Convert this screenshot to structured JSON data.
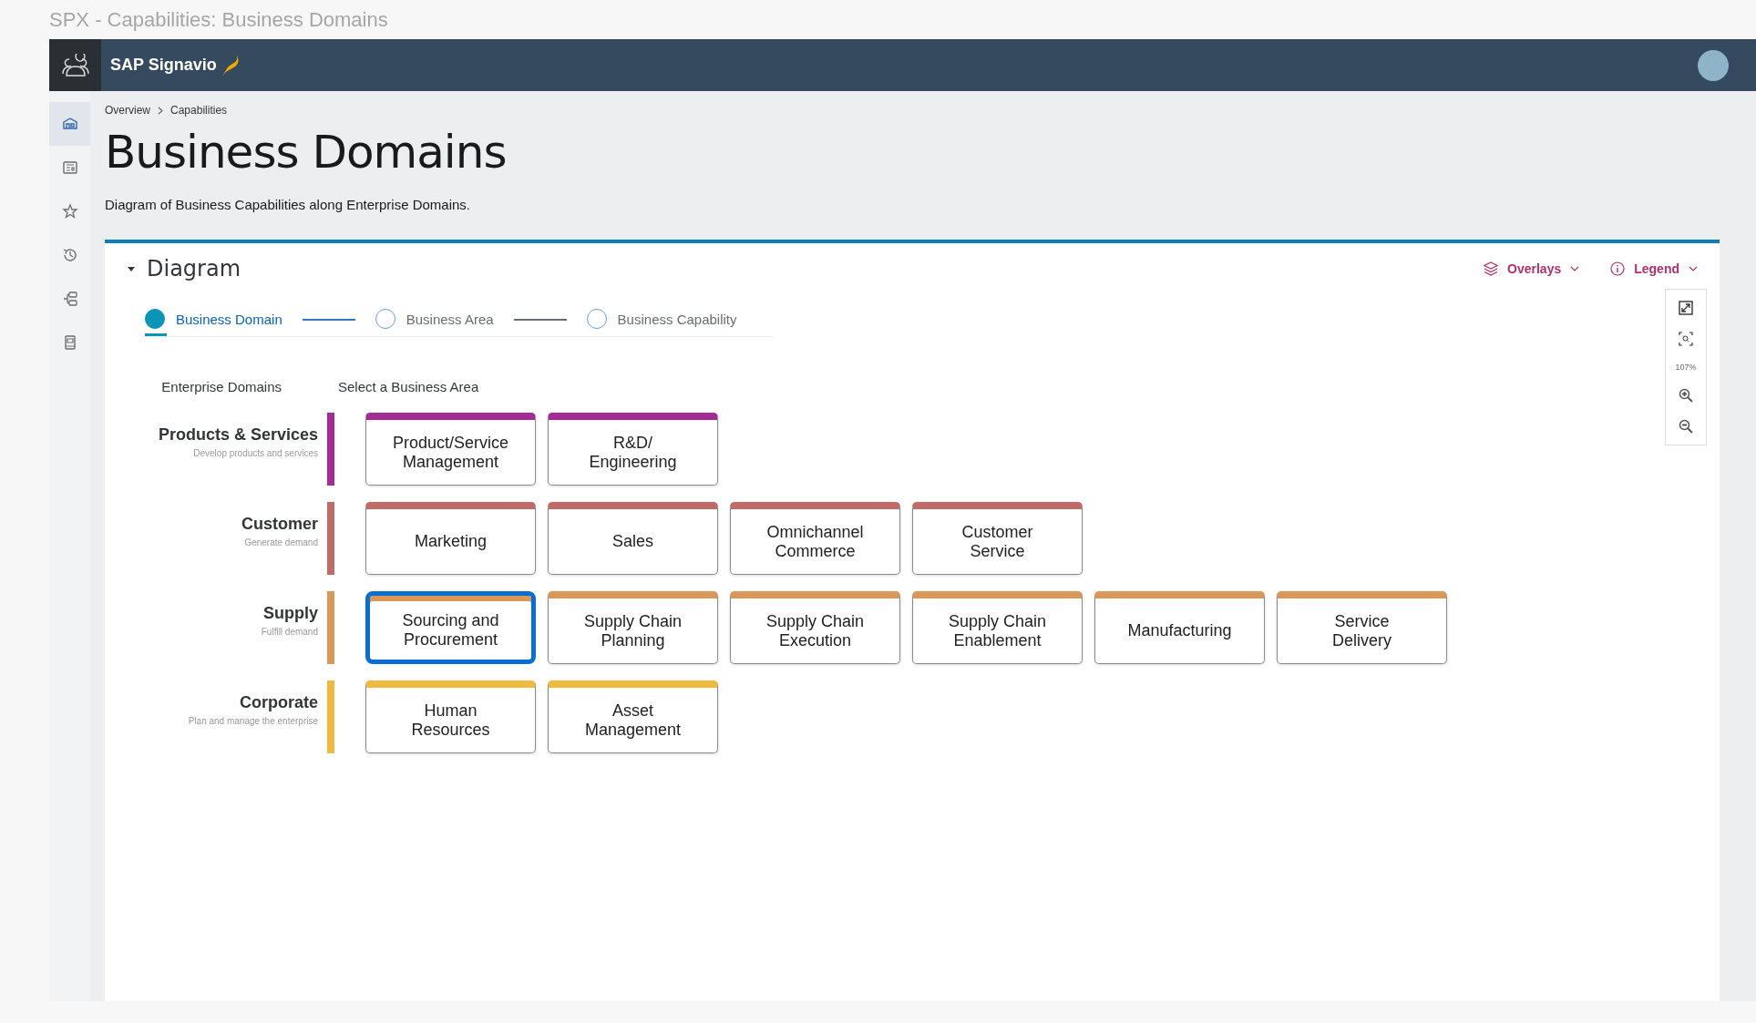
{
  "window": {
    "title": "SPX - Capabilities: Business Domains"
  },
  "header": {
    "brand": "SAP Signavio"
  },
  "sidebar": {
    "items": [
      {
        "selected": true
      },
      {
        "selected": false
      },
      {
        "selected": false
      },
      {
        "selected": false
      },
      {
        "selected": false
      },
      {
        "selected": false
      }
    ]
  },
  "breadcrumb": [
    "Overview",
    "Capabilities"
  ],
  "page": {
    "title": "Business Domains",
    "description": "Diagram of Business Capabilities along Enterprise Domains."
  },
  "panel": {
    "title": "Diagram",
    "expanded": true,
    "actions": [
      {
        "kind": "overlays",
        "label": "Overlays"
      },
      {
        "kind": "legend",
        "label": "Legend"
      }
    ]
  },
  "steps": [
    {
      "label": "Business Domain",
      "selected": true
    },
    {
      "label": "Business Area",
      "selected": false
    },
    {
      "label": "Business Capability",
      "selected": false
    }
  ],
  "columns": [
    "Enterprise Domains",
    "Select a Business Area"
  ],
  "domains": [
    {
      "name": "Products & Services",
      "subtitle": "Develop products and services",
      "color": "#a22b96",
      "areas": [
        {
          "label": "Product/Service Management",
          "selected": false
        },
        {
          "label": "R&D/ Engineering",
          "selected": false
        }
      ]
    },
    {
      "name": "Customer",
      "subtitle": "Generate demand",
      "color": "#c06b68",
      "areas": [
        {
          "label": "Marketing",
          "selected": false
        },
        {
          "label": "Sales",
          "selected": false
        },
        {
          "label": "Omnichannel Commerce",
          "selected": false
        },
        {
          "label": "Customer Service",
          "selected": false
        }
      ]
    },
    {
      "name": "Supply",
      "subtitle": "Fulfill demand",
      "color": "#d99855",
      "areas": [
        {
          "label": "Sourcing and Procurement",
          "selected": true
        },
        {
          "label": "Supply Chain Planning",
          "selected": false
        },
        {
          "label": "Supply Chain Execution",
          "selected": false
        },
        {
          "label": "Supply Chain Enablement",
          "selected": false
        },
        {
          "label": "Manufacturing",
          "selected": false
        },
        {
          "label": "Service Delivery",
          "selected": false
        }
      ]
    },
    {
      "name": "Corporate",
      "subtitle": "Plan and manage the enterprise",
      "color": "#f0b940",
      "areas": [
        {
          "label": "Human Resources",
          "selected": false
        },
        {
          "label": "Asset Management",
          "selected": false
        }
      ]
    }
  ],
  "zoom_toolbar": {
    "zoom": "107%"
  }
}
